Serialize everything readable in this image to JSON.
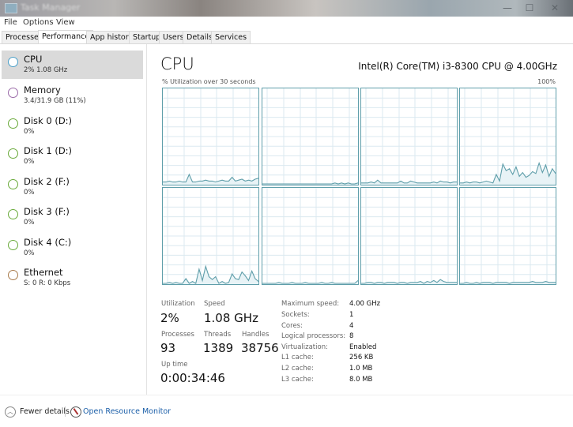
{
  "window": {
    "title": "Task Manager",
    "controls": {
      "minimize": "—",
      "maximize": "☐",
      "close": "✕"
    }
  },
  "menu": [
    "File",
    "Options",
    "View"
  ],
  "tabs": [
    {
      "label": "Processes",
      "active": false
    },
    {
      "label": "Performance",
      "active": true
    },
    {
      "label": "App history",
      "active": false
    },
    {
      "label": "Startup",
      "active": false
    },
    {
      "label": "Users",
      "active": false
    },
    {
      "label": "Details",
      "active": false
    },
    {
      "label": "Services",
      "active": false
    }
  ],
  "sidebar": {
    "items": [
      {
        "name": "CPU",
        "sub": "2%  1.08 GHz",
        "selected": true,
        "color": "#4a9fc8"
      },
      {
        "name": "Memory",
        "sub": "3.4/31.9 GB (11%)",
        "selected": false,
        "color": "#9a6aa8"
      },
      {
        "name": "Disk 0 (D:)",
        "sub": "0%",
        "selected": false,
        "color": "#6aaa3a"
      },
      {
        "name": "Disk 1 (D:)",
        "sub": "0%",
        "selected": false,
        "color": "#6aaa3a"
      },
      {
        "name": "Disk 2 (F:)",
        "sub": "0%",
        "selected": false,
        "color": "#6aaa3a"
      },
      {
        "name": "Disk 3 (F:)",
        "sub": "0%",
        "selected": false,
        "color": "#6aaa3a"
      },
      {
        "name": "Disk 4 (C:)",
        "sub": "0%",
        "selected": false,
        "color": "#6aaa3a"
      },
      {
        "name": "Ethernet",
        "sub": "S: 0 R: 0 Kbps",
        "selected": false,
        "color": "#a87a4a"
      }
    ]
  },
  "main": {
    "title": "CPU",
    "model": "Intel(R) Core(TM) i3-8300 CPU @ 4.00GHz",
    "util_label": "% Utilization over 30 seconds",
    "util_max": "100%",
    "chart_color": "#5f9eaa",
    "stats": {
      "utilization_label": "Utilization",
      "utilization": "2%",
      "speed_label": "Speed",
      "speed": "1.08 GHz",
      "processes_label": "Processes",
      "processes": "93",
      "threads_label": "Threads",
      "threads": "1389",
      "handles_label": "Handles",
      "handles": "38756",
      "uptime_label": "Up time",
      "uptime": "0:00:34:46"
    },
    "properties": [
      {
        "label": "Maximum speed:",
        "value": "4.00 GHz"
      },
      {
        "label": "Sockets:",
        "value": "1"
      },
      {
        "label": "Cores:",
        "value": "4"
      },
      {
        "label": "Logical processors:",
        "value": "8"
      },
      {
        "label": "Virtualization:",
        "value": "Enabled"
      },
      {
        "label": "L1 cache:",
        "value": "256 KB"
      },
      {
        "label": "L2 cache:",
        "value": "1.0 MB"
      },
      {
        "label": "L3 cache:",
        "value": "8.0 MB"
      }
    ]
  },
  "footer": {
    "fewer_details": "Fewer details",
    "resource_monitor": "Open Resource Monitor"
  },
  "chart_data": {
    "type": "line",
    "title": "% Utilization over 30 seconds",
    "ylim": [
      0,
      100
    ],
    "ymax_label": "100%",
    "grid": true,
    "series": [
      {
        "name": "Logical processor 0",
        "values": [
          2,
          2,
          3,
          2,
          2,
          3,
          2,
          2,
          10,
          2,
          2,
          3,
          3,
          4,
          3,
          3,
          2,
          3,
          4,
          3,
          3,
          7,
          3,
          4,
          5,
          3,
          4,
          3,
          5,
          6
        ]
      },
      {
        "name": "Logical processor 1",
        "values": [
          0,
          0,
          0,
          0,
          0,
          0,
          0,
          0,
          0,
          0,
          0,
          0,
          0,
          0,
          0,
          0,
          0,
          0,
          0,
          0,
          0,
          0,
          1,
          0,
          1,
          0,
          1,
          0,
          0,
          1
        ]
      },
      {
        "name": "Logical processor 2",
        "values": [
          1,
          1,
          1,
          2,
          1,
          4,
          1,
          1,
          1,
          1,
          1,
          1,
          3,
          1,
          1,
          3,
          2,
          1,
          1,
          1,
          1,
          1,
          2,
          1,
          3,
          2,
          2,
          1,
          2,
          2
        ]
      },
      {
        "name": "Logical processor 3",
        "values": [
          1,
          1,
          2,
          1,
          2,
          2,
          1,
          2,
          3,
          2,
          1,
          10,
          3,
          21,
          14,
          16,
          10,
          18,
          8,
          12,
          7,
          9,
          13,
          11,
          22,
          12,
          20,
          8,
          16,
          11
        ]
      },
      {
        "name": "Logical processor 4",
        "values": [
          0,
          0,
          1,
          0,
          1,
          0,
          0,
          5,
          0,
          2,
          0,
          15,
          3,
          18,
          7,
          4,
          7,
          0,
          2,
          0,
          1,
          10,
          5,
          4,
          12,
          8,
          3,
          13,
          5,
          2
        ]
      },
      {
        "name": "Logical processor 5",
        "values": [
          0,
          0,
          0,
          0,
          0,
          1,
          0,
          0,
          0,
          1,
          0,
          0,
          0,
          1,
          0,
          0,
          0,
          0,
          1,
          0,
          0,
          1,
          0,
          0,
          0,
          0,
          0,
          0,
          0,
          3
        ]
      },
      {
        "name": "Logical processor 6",
        "values": [
          0,
          0,
          1,
          1,
          0,
          1,
          1,
          0,
          1,
          1,
          1,
          0,
          1,
          1,
          0,
          1,
          1,
          1,
          2,
          0,
          2,
          1,
          3,
          1,
          4,
          2,
          1,
          1,
          1,
          1
        ]
      },
      {
        "name": "Logical processor 7",
        "values": [
          0,
          0,
          1,
          0,
          0,
          1,
          0,
          1,
          1,
          1,
          0,
          1,
          1,
          1,
          1,
          0,
          1,
          1,
          1,
          1,
          1,
          1,
          2,
          1,
          1,
          1,
          2,
          1,
          1,
          1
        ]
      }
    ]
  }
}
